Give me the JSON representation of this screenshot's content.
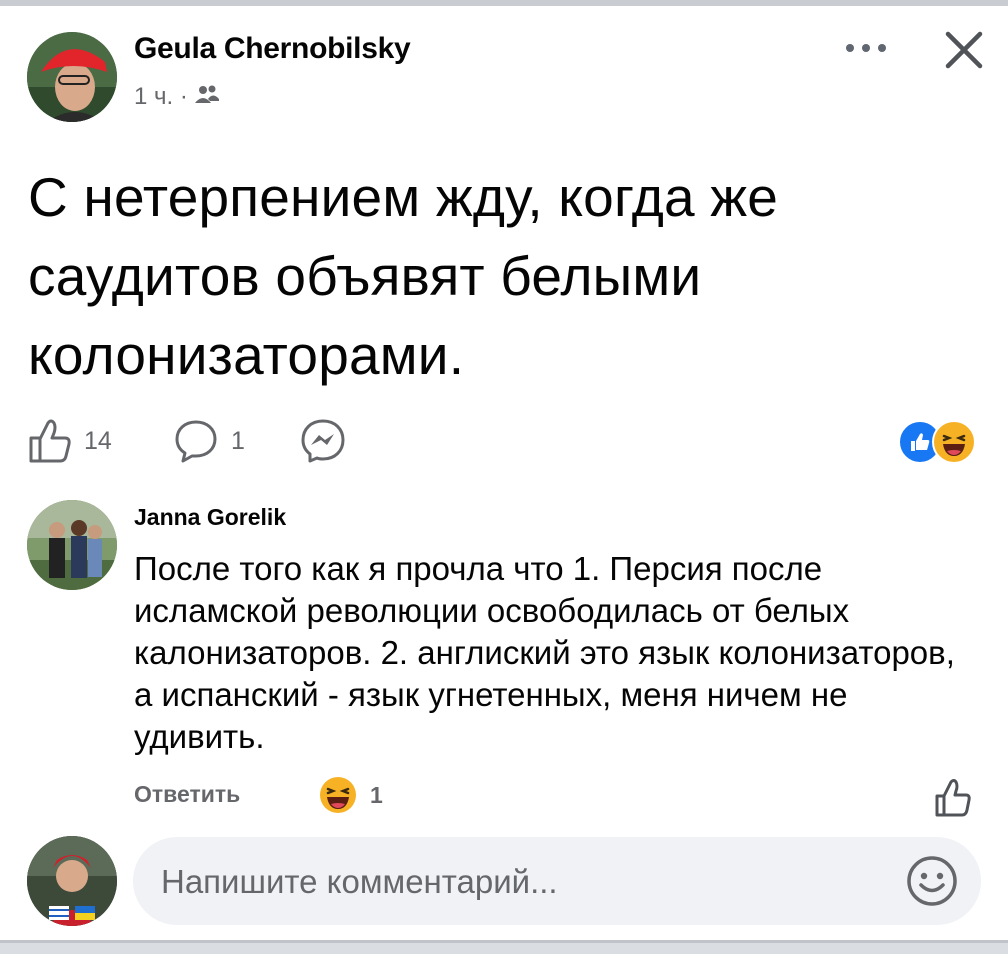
{
  "post": {
    "author": "Geula Chernobilsky",
    "time": "1 ч. ·",
    "audience_icon": "friends-icon",
    "text": "С нетерпением жду, когда же саудитов объявят белыми колонизаторами.",
    "likes": "14",
    "comments": "1"
  },
  "comment": {
    "author": "Janna Gorelik",
    "text": "После того как я прочла что 1. Персия после исламской революции освободилась от белых калонизаторов. 2. англиский это язык колонизаторов, а испанский - язык угнетенных, меня ничем не удивить.",
    "reply_label": "Ответить",
    "reaction_count": "1"
  },
  "composer": {
    "placeholder": "Напишите комментарий..."
  },
  "colors": {
    "text_primary": "#050505",
    "text_secondary": "#65676b",
    "like_blue": "#1877f2",
    "haha_yellow": "#f7b125",
    "composer_bg": "#f0f2f5"
  },
  "icons": [
    "more-icon",
    "close-icon",
    "like-icon",
    "comment-icon",
    "messenger-icon",
    "like-reaction-icon",
    "haha-reaction-icon",
    "emoji-icon"
  ]
}
